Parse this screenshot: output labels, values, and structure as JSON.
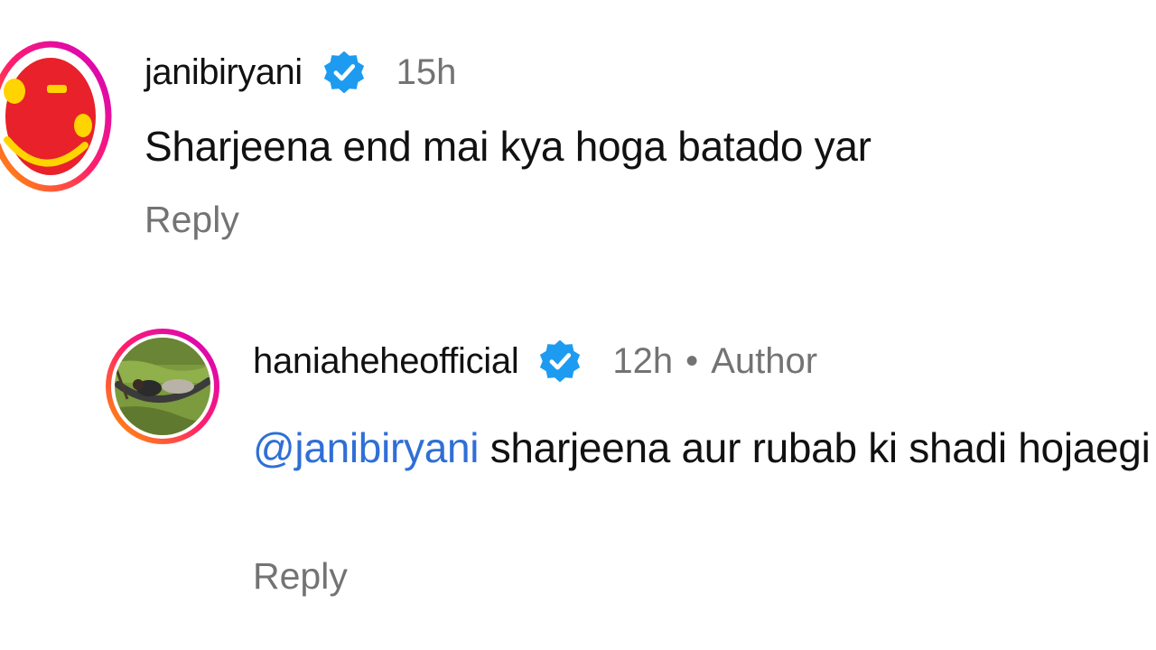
{
  "colors": {
    "verified_badge": "#1d9bf0",
    "mention": "#2f6fd6",
    "secondary_text": "#737373",
    "story_ring_start": "#d300c5",
    "story_ring_end": "#ff7a00"
  },
  "comments": [
    {
      "username": "janibiryani",
      "verified": true,
      "verified_icon": "verified-badge-icon",
      "time": "15h",
      "text": "Sharjeena end mai kya hoga batado yar",
      "reply_label": "Reply",
      "avatar": "smiley-logo-avatar"
    },
    {
      "username": "haniaheheofficial",
      "verified": true,
      "verified_icon": "verified-badge-icon",
      "time": "12h",
      "separator": "•",
      "author_label": "Author",
      "mention": "@janibiryani",
      "text": " sharjeena aur rubab ki shadi hojaegi",
      "reply_label": "Reply",
      "avatar": "photo-avatar-hammock"
    }
  ]
}
